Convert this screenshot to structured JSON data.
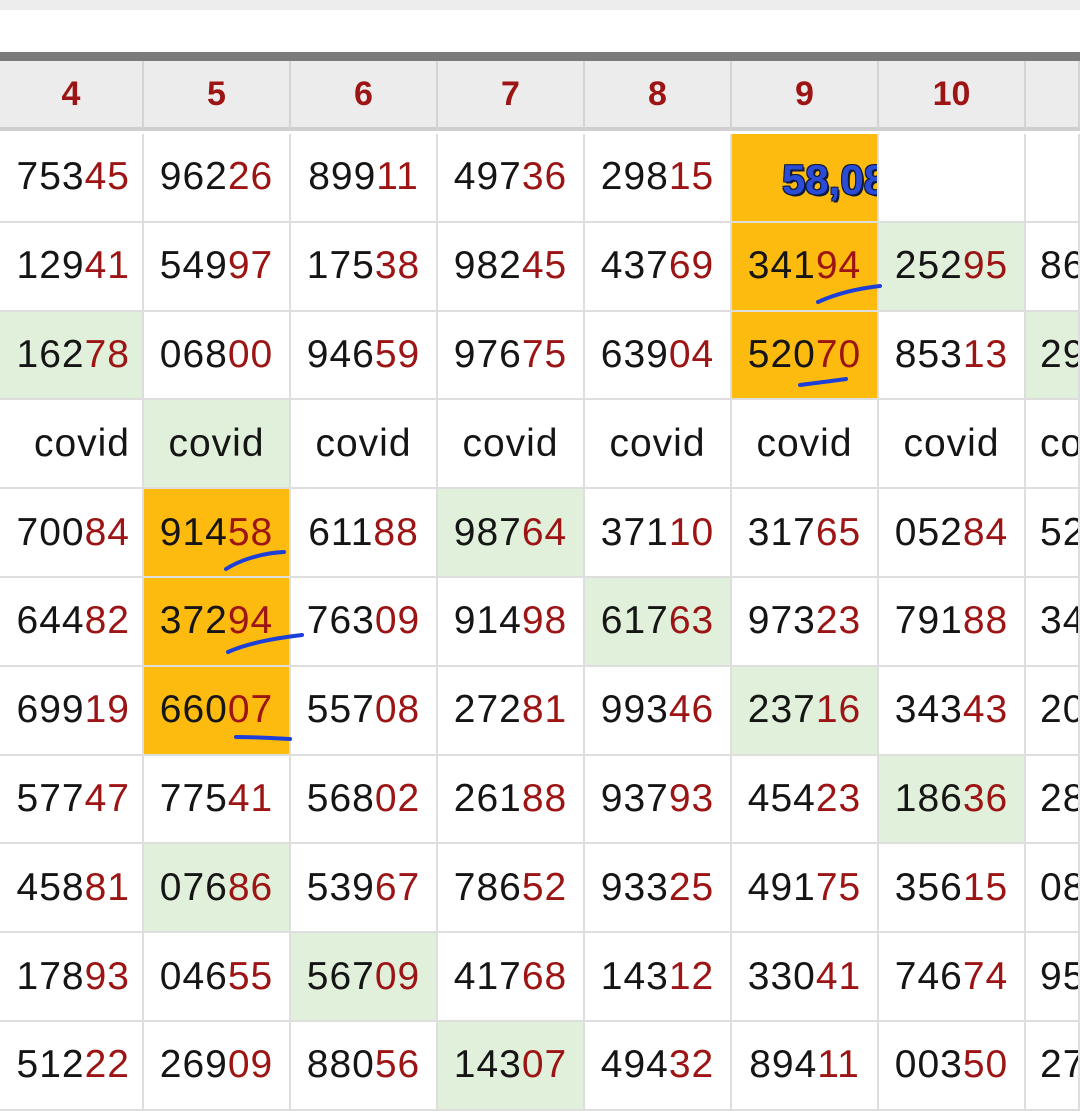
{
  "headers": [
    "4",
    "5",
    "6",
    "7",
    "8",
    "9",
    "10",
    ""
  ],
  "rows": [
    [
      {
        "p": "753",
        "s": "45"
      },
      {
        "p": "962",
        "s": "26"
      },
      {
        "p": "899",
        "s": "11"
      },
      {
        "p": "497",
        "s": "36"
      },
      {
        "p": "298",
        "s": "15"
      },
      {
        "label": "58,08",
        "bg": "orange"
      },
      {
        "p": "",
        "s": ""
      },
      {
        "p": "",
        "s": ""
      }
    ],
    [
      {
        "p": "129",
        "s": "41"
      },
      {
        "p": "549",
        "s": "97"
      },
      {
        "p": "175",
        "s": "38"
      },
      {
        "p": "982",
        "s": "45"
      },
      {
        "p": "437",
        "s": "69"
      },
      {
        "p": "341",
        "s": "94",
        "bg": "orange"
      },
      {
        "p": "252",
        "s": "95",
        "bg": "green"
      },
      {
        "p": "86",
        "s": ""
      }
    ],
    [
      {
        "p": "162",
        "s": "78",
        "bg": "green"
      },
      {
        "p": "068",
        "s": "00"
      },
      {
        "p": "946",
        "s": "59"
      },
      {
        "p": "976",
        "s": "75"
      },
      {
        "p": "639",
        "s": "04"
      },
      {
        "p": "520",
        "s": "70",
        "bg": "orange"
      },
      {
        "p": "853",
        "s": "13"
      },
      {
        "p": "29",
        "s": "",
        "bg": "green"
      }
    ],
    [
      {
        "t": "covid"
      },
      {
        "t": "covid",
        "bg": "green"
      },
      {
        "t": "covid"
      },
      {
        "t": "covid"
      },
      {
        "t": "covid"
      },
      {
        "t": "covid"
      },
      {
        "t": "covid"
      },
      {
        "t": "co"
      }
    ],
    [
      {
        "p": "700",
        "s": "84"
      },
      {
        "p": "914",
        "s": "58",
        "bg": "orange"
      },
      {
        "p": "611",
        "s": "88"
      },
      {
        "p": "987",
        "s": "64",
        "bg": "green"
      },
      {
        "p": "371",
        "s": "10"
      },
      {
        "p": "317",
        "s": "65"
      },
      {
        "p": "052",
        "s": "84"
      },
      {
        "p": "52",
        "s": ""
      }
    ],
    [
      {
        "p": "644",
        "s": "82"
      },
      {
        "p": "372",
        "s": "94",
        "bg": "orange"
      },
      {
        "p": "763",
        "s": "09"
      },
      {
        "p": "914",
        "s": "98"
      },
      {
        "p": "617",
        "s": "63",
        "bg": "green"
      },
      {
        "p": "973",
        "s": "23"
      },
      {
        "p": "791",
        "s": "88"
      },
      {
        "p": "34",
        "s": ""
      }
    ],
    [
      {
        "p": "699",
        "s": "19"
      },
      {
        "p": "660",
        "s": "07",
        "bg": "orange"
      },
      {
        "p": "557",
        "s": "08"
      },
      {
        "p": "272",
        "s": "81"
      },
      {
        "p": "993",
        "s": "46"
      },
      {
        "p": "237",
        "s": "16",
        "bg": "green"
      },
      {
        "p": "343",
        "s": "43"
      },
      {
        "p": "20",
        "s": ""
      }
    ],
    [
      {
        "p": "577",
        "s": "47"
      },
      {
        "p": "775",
        "s": "41"
      },
      {
        "p": "568",
        "s": "02"
      },
      {
        "p": "261",
        "s": "88"
      },
      {
        "p": "937",
        "s": "93"
      },
      {
        "p": "454",
        "s": "23"
      },
      {
        "p": "186",
        "s": "36",
        "bg": "green"
      },
      {
        "p": "28",
        "s": ""
      }
    ],
    [
      {
        "p": "458",
        "s": "81"
      },
      {
        "p": "076",
        "s": "86",
        "bg": "green"
      },
      {
        "p": "539",
        "s": "67"
      },
      {
        "p": "786",
        "s": "52"
      },
      {
        "p": "933",
        "s": "25"
      },
      {
        "p": "491",
        "s": "75"
      },
      {
        "p": "356",
        "s": "15"
      },
      {
        "p": "08",
        "s": ""
      }
    ],
    [
      {
        "p": "178",
        "s": "93"
      },
      {
        "p": "046",
        "s": "55"
      },
      {
        "p": "567",
        "s": "09",
        "bg": "green"
      },
      {
        "p": "417",
        "s": "68"
      },
      {
        "p": "143",
        "s": "12"
      },
      {
        "p": "330",
        "s": "41"
      },
      {
        "p": "746",
        "s": "74"
      },
      {
        "p": "95",
        "s": ""
      }
    ],
    [
      {
        "p": "512",
        "s": "22"
      },
      {
        "p": "269",
        "s": "09"
      },
      {
        "p": "880",
        "s": "56"
      },
      {
        "p": "143",
        "s": "07",
        "bg": "green"
      },
      {
        "p": "494",
        "s": "32"
      },
      {
        "p": "894",
        "s": "11"
      },
      {
        "p": "003",
        "s": "50"
      },
      {
        "p": "27",
        "s": ""
      }
    ]
  ],
  "colors": {
    "header_text": "#9c1414",
    "suffix_text": "#9c1414",
    "highlight_orange": "#fdbb10",
    "highlight_green": "#e1f0da",
    "pen_mark": "#1b3fd8"
  }
}
